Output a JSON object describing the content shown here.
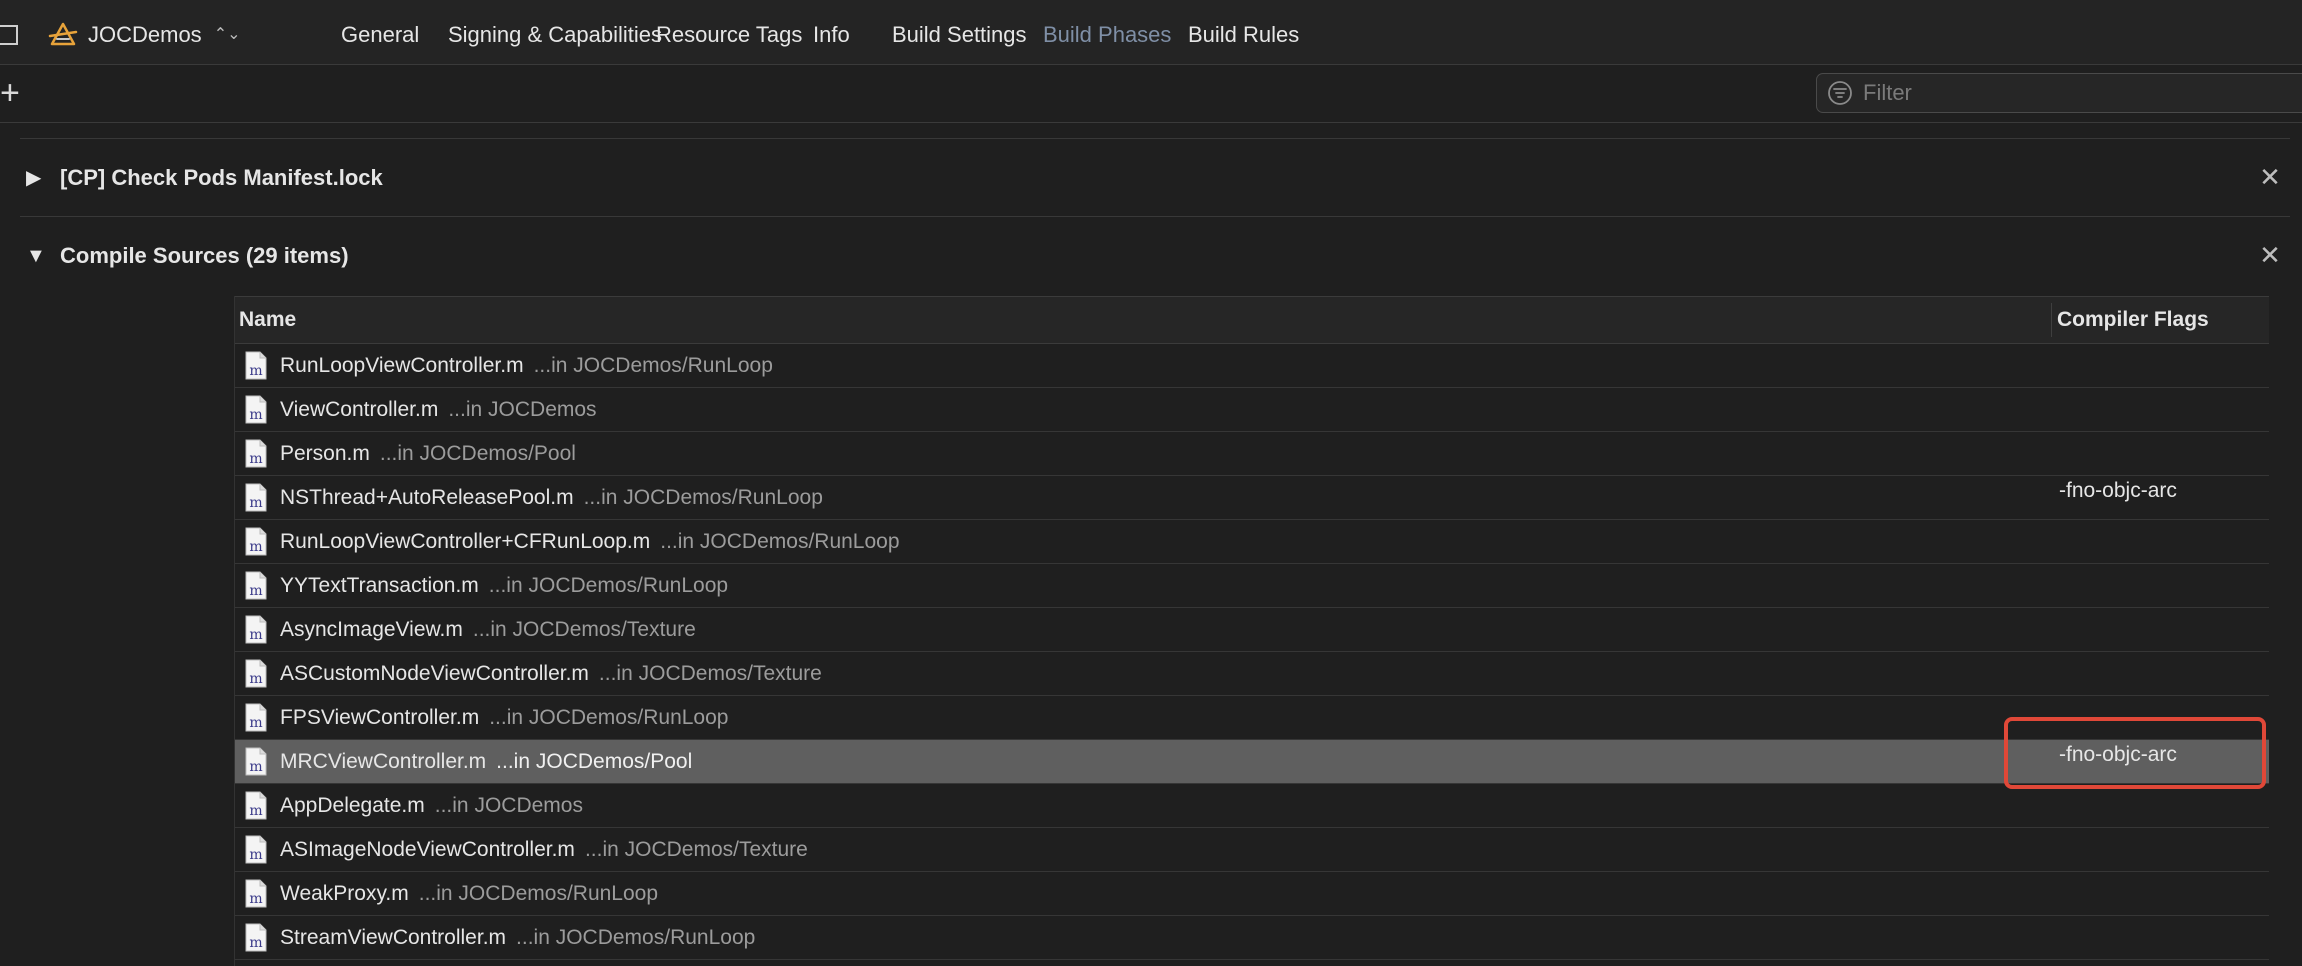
{
  "header": {
    "target_name": "JOCDemos",
    "tabs": [
      {
        "label": "General",
        "active": false
      },
      {
        "label": "Signing & Capabilities",
        "active": false
      },
      {
        "label": "Resource Tags",
        "active": false
      },
      {
        "label": "Info",
        "active": false
      },
      {
        "label": "Build Settings",
        "active": false
      },
      {
        "label": "Build Phases",
        "active": true
      },
      {
        "label": "Build Rules",
        "active": false
      }
    ]
  },
  "toolbar": {
    "filter_placeholder": "Filter",
    "add_symbol": "+"
  },
  "phases": {
    "check_pods": {
      "title": "[CP] Check Pods Manifest.lock",
      "expanded": false
    },
    "compile_sources": {
      "title": "Compile Sources (29 items)",
      "expanded": true
    }
  },
  "table": {
    "columns": {
      "name": "Name",
      "flags": "Compiler Flags"
    },
    "rows": [
      {
        "name": "RunLoopViewController.m",
        "path": "...in JOCDemos/RunLoop",
        "flags": ""
      },
      {
        "name": "ViewController.m",
        "path": "...in JOCDemos",
        "flags": ""
      },
      {
        "name": "Person.m",
        "path": "...in JOCDemos/Pool",
        "flags": ""
      },
      {
        "name": "NSThread+AutoReleasePool.m",
        "path": "...in JOCDemos/RunLoop",
        "flags": "-fno-objc-arc"
      },
      {
        "name": "RunLoopViewController+CFRunLoop.m",
        "path": "...in JOCDemos/RunLoop",
        "flags": ""
      },
      {
        "name": "YYTextTransaction.m",
        "path": "...in JOCDemos/RunLoop",
        "flags": ""
      },
      {
        "name": "AsyncImageView.m",
        "path": "...in JOCDemos/Texture",
        "flags": ""
      },
      {
        "name": "ASCustomNodeViewController.m",
        "path": "...in JOCDemos/Texture",
        "flags": ""
      },
      {
        "name": "FPSViewController.m",
        "path": "...in JOCDemos/RunLoop",
        "flags": ""
      },
      {
        "name": "MRCViewController.m",
        "path": "...in JOCDemos/Pool",
        "flags": "-fno-objc-arc",
        "selected": true
      },
      {
        "name": "AppDelegate.m",
        "path": "...in JOCDemos",
        "flags": ""
      },
      {
        "name": "ASImageNodeViewController.m",
        "path": "...in JOCDemos/Texture",
        "flags": ""
      },
      {
        "name": "WeakProxy.m",
        "path": "...in JOCDemos/RunLoop",
        "flags": ""
      },
      {
        "name": "StreamViewController.m",
        "path": "...in JOCDemos/RunLoop",
        "flags": ""
      }
    ]
  },
  "colors": {
    "accent_tab": "#7f8fa6",
    "highlight_box": "#e04838",
    "selected_row": "#5f5f5f"
  }
}
